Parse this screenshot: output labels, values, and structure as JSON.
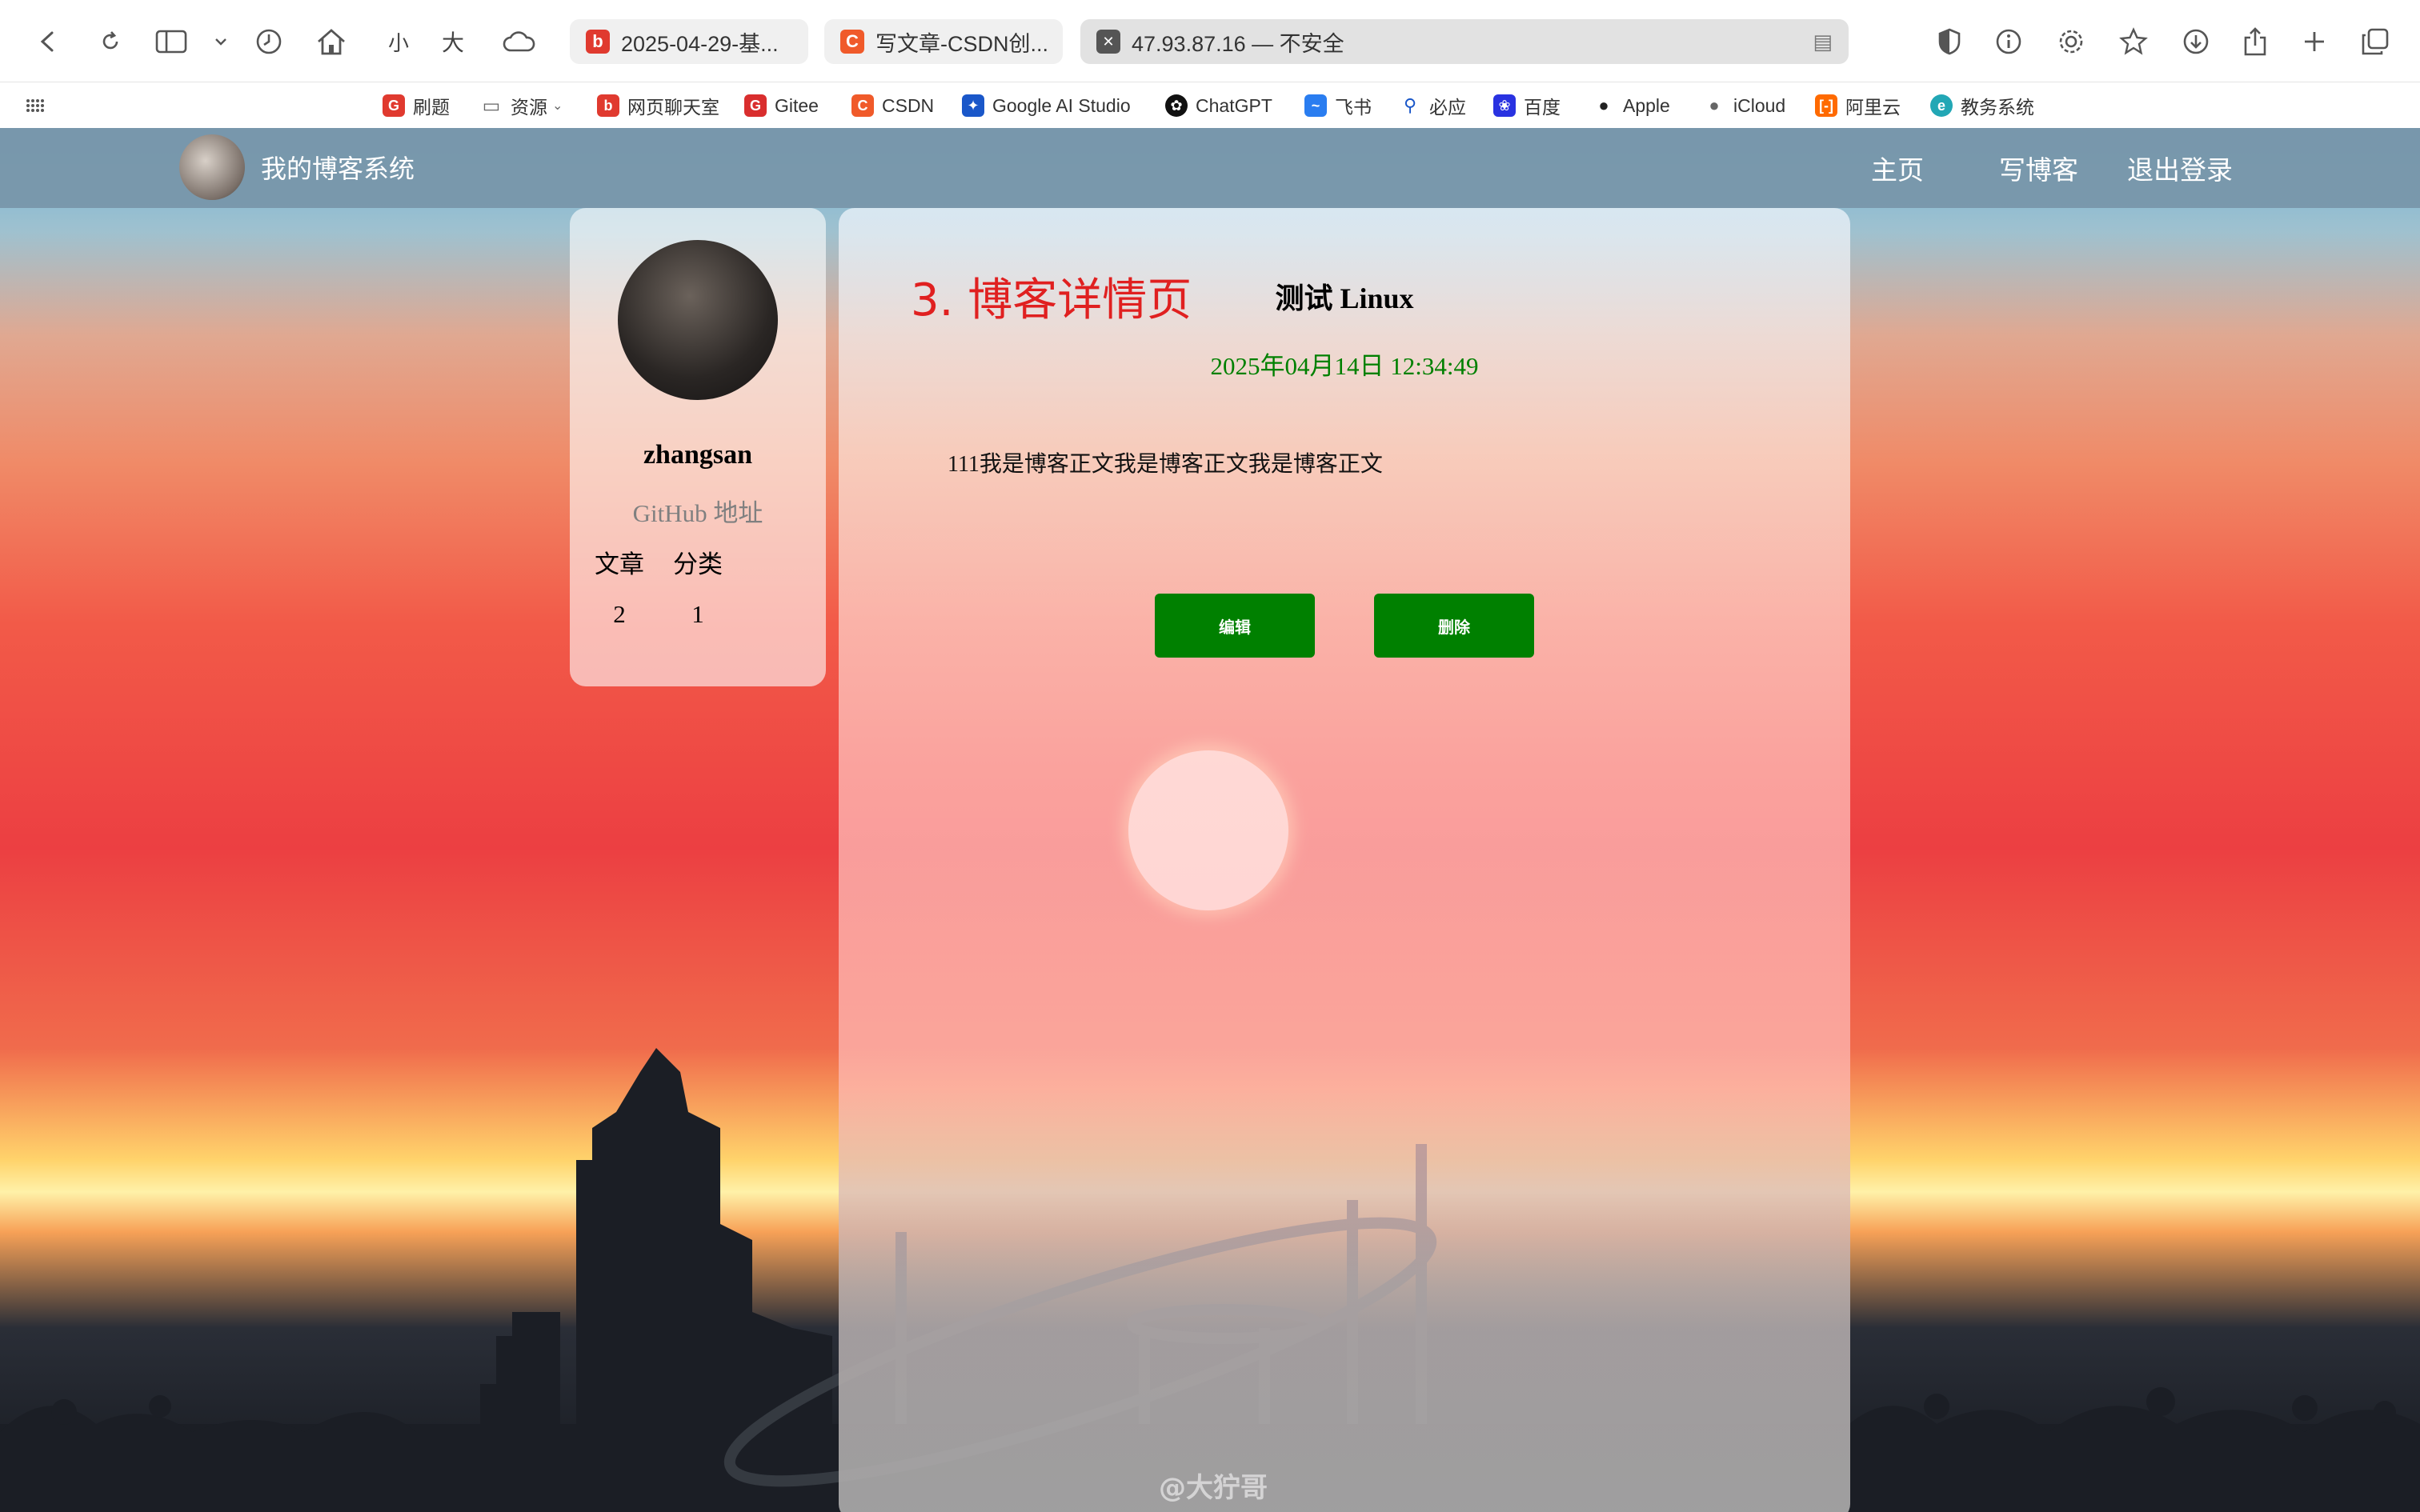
{
  "browser": {
    "tabs": [
      {
        "title": "2025-04-29-基..."
      },
      {
        "title": "写文章-CSDN创..."
      },
      {
        "title": "47.93.87.16 — 不安全"
      }
    ],
    "text_small": "小",
    "text_large": "大",
    "bookmarks": [
      "刷题",
      "资源",
      "网页聊天室",
      "Gitee",
      "CSDN",
      "Google AI Studio",
      "ChatGPT",
      "飞书",
      "必应",
      "百度",
      "Apple",
      "iCloud",
      "阿里云",
      "教务系统"
    ]
  },
  "nav": {
    "site_title": "我的博客系统",
    "links": [
      "主页",
      "写博客",
      "退出登录"
    ]
  },
  "profile": {
    "username": "zhangsan",
    "github": "GitHub 地址",
    "stat_labels": [
      "文章",
      "分类"
    ],
    "stat_values": [
      "2",
      "1"
    ]
  },
  "blog": {
    "annotation": "3. 博客详情页",
    "title": "测试 Linux",
    "date": "2025年04月14日 12:34:49",
    "content": "111我是博客正文我是博客正文我是博客正文",
    "edit_label": "编辑",
    "delete_label": "删除",
    "watermark": "@大狞哥"
  },
  "colors": {
    "nav_bg": "#7896aa",
    "button_green": "#008000",
    "date_green": "#008000",
    "annotation_red": "#e02020"
  }
}
